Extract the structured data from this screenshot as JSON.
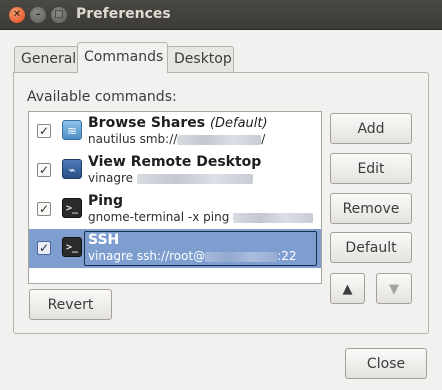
{
  "window": {
    "title": "Preferences",
    "close_glyph": "✕",
    "minimize_glyph": "–",
    "maximize_glyph": "□"
  },
  "tabs": [
    "General",
    "Commands",
    "Desktop"
  ],
  "active_tab": "Commands",
  "section_label": "Available commands:",
  "commands": [
    {
      "name": "Browse Shares",
      "hint": "(Default)",
      "detail_prefix": "nautilus smb://",
      "detail_suffix": "/",
      "checked": true,
      "icon": "folder-share-icon",
      "selected": false
    },
    {
      "name": "View Remote Desktop",
      "hint": "",
      "detail_prefix": "vinagre",
      "detail_suffix": "",
      "checked": true,
      "icon": "remote-desktop-icon",
      "selected": false
    },
    {
      "name": "Ping",
      "hint": "",
      "detail_prefix": "gnome-terminal -x ping",
      "detail_suffix": "",
      "checked": true,
      "icon": "terminal-icon",
      "selected": false
    },
    {
      "name": "SSH",
      "hint": "",
      "detail_prefix": "vinagre ssh://root@",
      "detail_suffix": ":22",
      "checked": true,
      "icon": "terminal-icon",
      "selected": true
    }
  ],
  "buttons": {
    "add": "Add",
    "edit": "Edit",
    "remove": "Remove",
    "default": "Default",
    "revert": "Revert",
    "close": "Close",
    "move_up": "▲",
    "move_down": "▼"
  },
  "colors": {
    "selection": "#7e9ed0",
    "titlebar": "#3c3b37",
    "close_button": "#e65b24"
  }
}
